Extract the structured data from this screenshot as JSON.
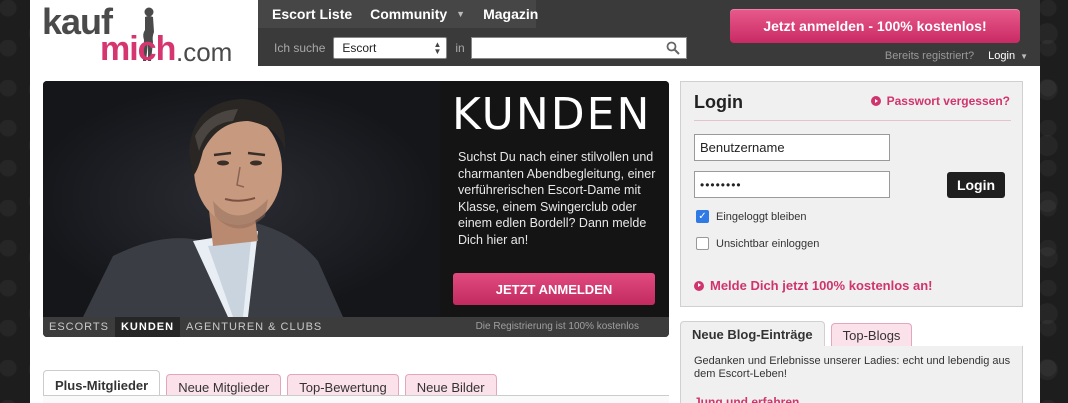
{
  "logo": {
    "top": "kauf",
    "bottom": "mich",
    "suffix": ".com"
  },
  "nav": {
    "items": [
      {
        "label": "Escort Liste"
      },
      {
        "label": "Community"
      },
      {
        "label": "Magazin"
      }
    ]
  },
  "search": {
    "label": "Ich suche",
    "category_selected": "Escort",
    "in_label": "in",
    "location_value": ""
  },
  "header": {
    "cta_label": "Jetzt anmelden - 100% kostenlos!",
    "already_registered": "Bereits registriert?",
    "login_label": "Login"
  },
  "hero": {
    "title": "KUNDEN",
    "text": "Suchst Du nach einer stilvollen und charmanten Abendbegleitung, einer verführerischen Escort-Dame mit Klasse, einem Swingerclub oder einem edlen Bordell? Dann melde Dich hier an!",
    "button_label": "JETZT ANMELDEN",
    "tabs": [
      {
        "label": "ESCORTS",
        "active": false
      },
      {
        "label": "KUNDEN",
        "active": true
      },
      {
        "label": "AGENTUREN & CLUBS",
        "active": false
      }
    ],
    "note": "Die Registrierung ist 100% kostenlos"
  },
  "member_tabs": [
    {
      "label": "Plus-Mitglieder",
      "active": true
    },
    {
      "label": "Neue Mitglieder",
      "active": false
    },
    {
      "label": "Top-Bewertung",
      "active": false
    },
    {
      "label": "Neue Bilder",
      "active": false
    }
  ],
  "login": {
    "title": "Login",
    "forgot_password": "Passwort vergessen?",
    "username_value": "Benutzername",
    "password_value": "••••••••",
    "button_label": "Login",
    "remember": {
      "label": "Eingeloggt bleiben",
      "checked": true
    },
    "invisible": {
      "label": "Unsichtbar einloggen",
      "checked": false
    },
    "register_link": "Melde Dich jetzt 100% kostenlos an!"
  },
  "blog": {
    "tabs": [
      {
        "label": "Neue Blog-Einträge",
        "active": true
      },
      {
        "label": "Top-Blogs",
        "active": false
      }
    ],
    "description": "Gedanken und Erlebnisse unserer Ladies: echt und lebendig aus dem Escort-Leben!",
    "first_entry": "Jung und erfahren"
  },
  "colors": {
    "brand_pink": "#d0346c",
    "header_dark": "#3a3a3a",
    "login_button": "#1f1f1f",
    "checkbox_blue": "#2f7ae5"
  },
  "icons": {
    "search": "magnifier-icon",
    "bullet": "arrow-bullet-icon",
    "caret": "chevron-down-icon"
  }
}
